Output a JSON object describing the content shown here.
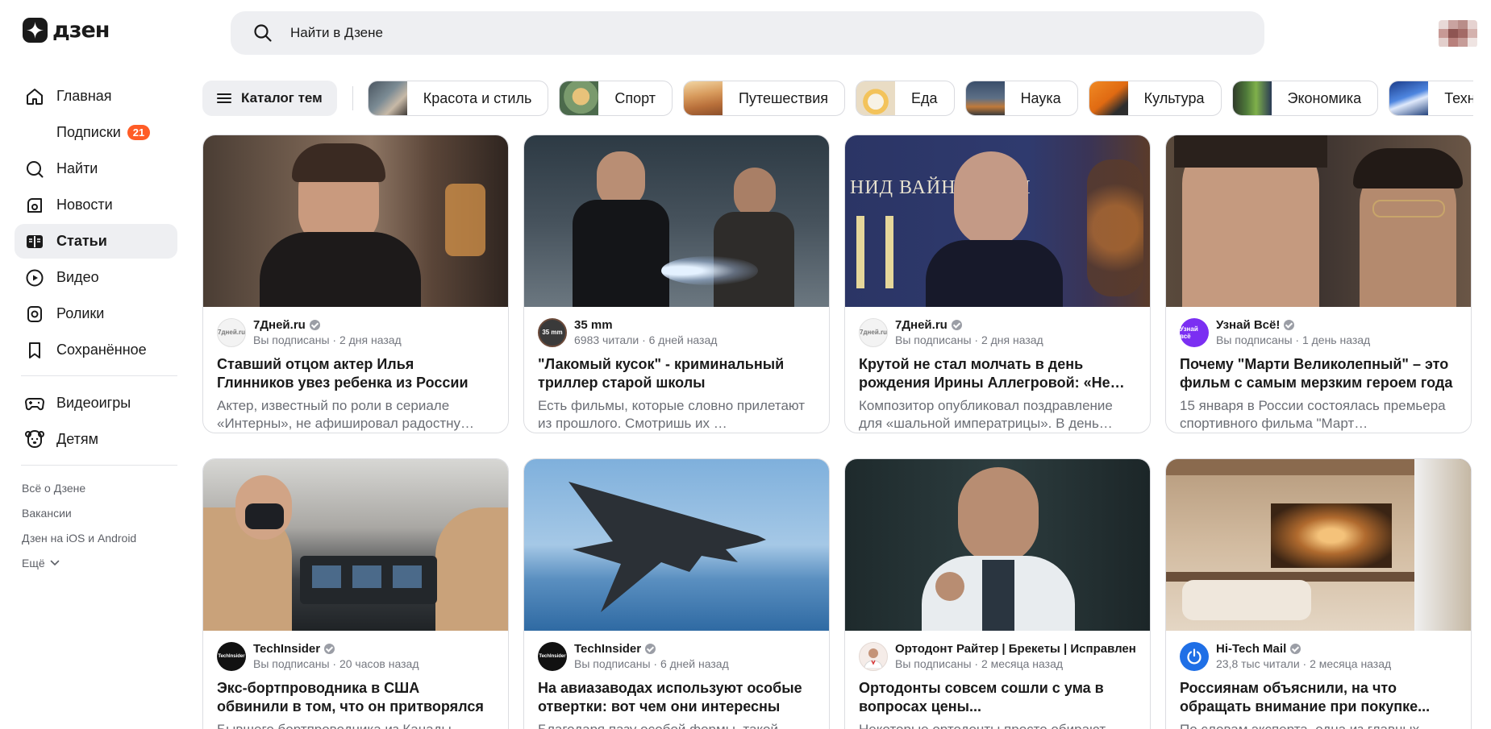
{
  "header": {
    "logo_text": "дзен",
    "search_placeholder": "Найти в Дзене"
  },
  "sidebar": {
    "items": [
      {
        "label": "Главная",
        "icon": "home-icon"
      },
      {
        "label": "Подписки",
        "badge": "21"
      },
      {
        "label": "Найти",
        "icon": "search-icon"
      },
      {
        "label": "Новости",
        "icon": "news-icon"
      },
      {
        "label": "Статьи",
        "icon": "articles-icon",
        "active": true
      },
      {
        "label": "Видео",
        "icon": "video-icon"
      },
      {
        "label": "Ролики",
        "icon": "shorts-icon"
      },
      {
        "label": "Сохранённое",
        "icon": "bookmark-icon"
      }
    ],
    "extra_items": [
      {
        "label": "Видеоигры",
        "icon": "gamepad-icon"
      },
      {
        "label": "Детям",
        "icon": "kids-bear-icon"
      }
    ],
    "footer_links": [
      "Всё о Дзене",
      "Вакансии",
      "Дзен на iOS и Android",
      "Ещё"
    ]
  },
  "categories": {
    "catalog_label": "Каталог тем",
    "chips": [
      "Красота и стиль",
      "Спорт",
      "Путешествия",
      "Еда",
      "Наука",
      "Культура",
      "Экономика",
      "Техн"
    ]
  },
  "cards": [
    {
      "source": "7Дней.ru",
      "ava_text": "7дней.ru",
      "subline": "Вы подписаны · 2 дня назад",
      "title": "Ставший отцом актер Илья Глинников увез ребенка из России",
      "desc": "Актер, известный по роли в сериале «Интерны», не афишировал радостну…"
    },
    {
      "source": "35 mm",
      "ava_text": "35 mm",
      "subline": "6983 читали · 6 дней назад",
      "title": "\"Лакомый кусок\" - криминальный триллер старой школы",
      "desc": "Есть фильмы, которые словно прилетают из прошлого. Смотришь их …"
    },
    {
      "source": "7Дней.ru",
      "ava_text": "7дней.ru",
      "subline": "Вы подписаны · 2 дня назад",
      "title": "Крутой не стал молчать в день рождения Ирины Аллегровой: «Не…",
      "desc": "Композитор опубликовал поздравление для «шальной императрицы». В день…",
      "img_text": "НИД ВАЙНШТЕЙН"
    },
    {
      "source": "Узнай Всё!",
      "ava_text": "Узнай всё",
      "subline": "Вы подписаны · 1 день назад",
      "title": "Почему \"Марти Великолепный\" – это фильм с самым мерзким героем года",
      "desc": "15 января в России состоялась премьера спортивного фильма \"Март…"
    },
    {
      "source": "TechInsider",
      "ava_text": "TechInsider",
      "subline": "Вы подписаны · 20 часов назад",
      "title": "Экс-бортпроводника в США обвинили в том, что он притворялся пилотом",
      "desc": "Бывшего бортпроводника из Канады…"
    },
    {
      "source": "TechInsider",
      "ava_text": "TechInsider",
      "subline": "Вы подписаны · 6 дней назад",
      "title": "На авиазаводах используют особые отвертки: вот чем они интересны",
      "desc": "Благодаря пазу особой формы, такой…"
    },
    {
      "source": "Ортодонт Райтер | Брекеты | Исправлен…",
      "ava_text": "",
      "subline": "Вы подписаны · 2 месяца назад",
      "title": "Ортодонты совсем сошли с ума в вопросах цены...",
      "desc": "Некоторые ортодонты просто обирают…"
    },
    {
      "source": "Hi-Tech Mail",
      "ava_text": "",
      "subline": "23,8 тыс читали · 2 месяца назад",
      "title": "Россиянам объяснили, на что обращать внимание при покупке...",
      "desc": "По словам эксперта, одна из главных…"
    }
  ],
  "colors": {
    "accent_badge": "#ff5c26",
    "active_bg": "#eeeff2"
  }
}
